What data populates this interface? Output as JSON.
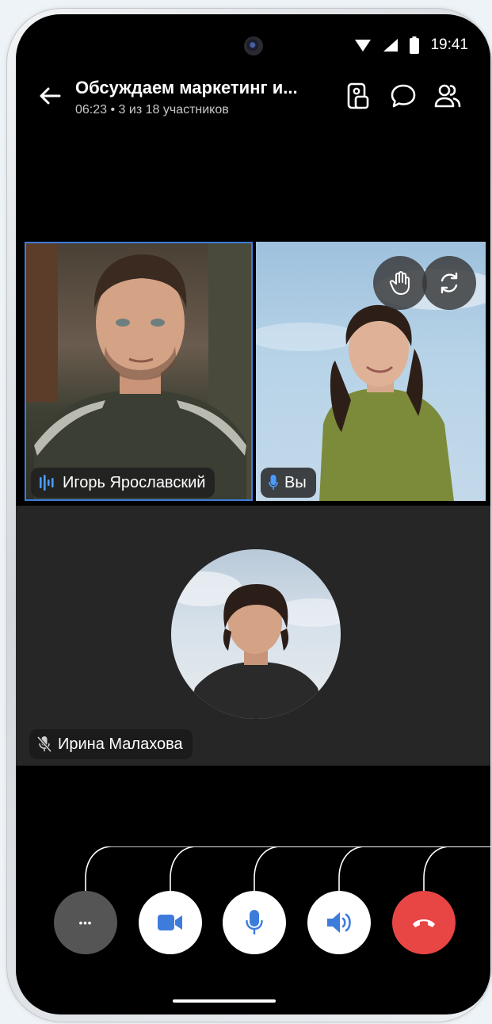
{
  "status_bar": {
    "time": "19:41"
  },
  "header": {
    "title": "Обсуждаем маркетинг и...",
    "subtitle": "06:23 • 3 из 18 участников"
  },
  "participants": {
    "igor": {
      "name": "Игорь Ярославский",
      "status": "speaking"
    },
    "you": {
      "name": "Вы",
      "status": "mic-on"
    },
    "irina": {
      "name": "Ирина Малахова",
      "status": "muted"
    }
  },
  "controls": [
    {
      "name": "more",
      "icon": "more-dots-icon",
      "label": "•••"
    },
    {
      "name": "camera",
      "icon": "video-camera-icon"
    },
    {
      "name": "microphone",
      "icon": "microphone-icon"
    },
    {
      "name": "speaker",
      "icon": "speaker-icon"
    },
    {
      "name": "end-call",
      "icon": "end-call-icon"
    }
  ],
  "colors": {
    "accent": "#3d7cdb",
    "end_call": "#e84545",
    "more_button": "#555555",
    "tile_background": "#262626"
  }
}
